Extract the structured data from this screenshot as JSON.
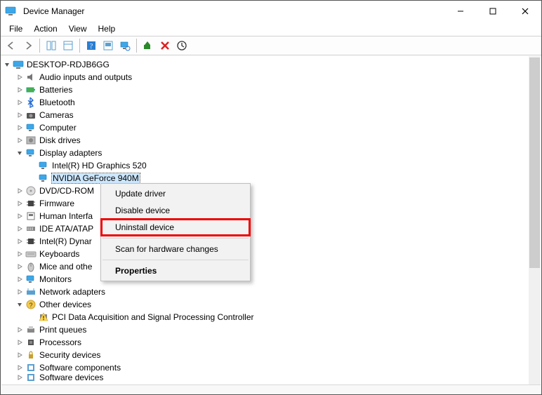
{
  "titlebar": {
    "title": "Device Manager"
  },
  "menu": {
    "file": "File",
    "action": "Action",
    "view": "View",
    "help": "Help"
  },
  "tree": {
    "root": "DESKTOP-RDJB6GG",
    "items": [
      {
        "label": "Audio inputs and outputs",
        "icon": "speaker"
      },
      {
        "label": "Batteries",
        "icon": "battery"
      },
      {
        "label": "Bluetooth",
        "icon": "bluetooth"
      },
      {
        "label": "Cameras",
        "icon": "camera"
      },
      {
        "label": "Computer",
        "icon": "monitor"
      },
      {
        "label": "Disk drives",
        "icon": "disk"
      },
      {
        "label": "Display adapters",
        "icon": "monitor",
        "expanded": true,
        "children": [
          {
            "label": "Intel(R) HD Graphics 520",
            "icon": "monitor"
          },
          {
            "label": "NVIDIA GeForce 940M",
            "icon": "monitor",
            "selected": true
          }
        ]
      },
      {
        "label": "DVD/CD-ROM",
        "icon": "dvd",
        "truncated": true
      },
      {
        "label": "Firmware",
        "icon": "chip"
      },
      {
        "label": "Human Interfa",
        "icon": "hid",
        "truncated": true
      },
      {
        "label": "IDE ATA/ATAP",
        "icon": "ide",
        "truncated": true
      },
      {
        "label": "Intel(R) Dynar",
        "icon": "chip",
        "truncated": true
      },
      {
        "label": "Keyboards",
        "icon": "keyboard"
      },
      {
        "label": "Mice and othe",
        "icon": "mouse",
        "truncated": true
      },
      {
        "label": "Monitors",
        "icon": "monitor"
      },
      {
        "label": "Network adapters",
        "icon": "network"
      },
      {
        "label": "Other devices",
        "icon": "other",
        "expanded": true,
        "children": [
          {
            "label": "PCI Data Acquisition and Signal Processing Controller",
            "icon": "warn"
          }
        ]
      },
      {
        "label": "Print queues",
        "icon": "printer"
      },
      {
        "label": "Processors",
        "icon": "cpu"
      },
      {
        "label": "Security devices",
        "icon": "security"
      },
      {
        "label": "Software components",
        "icon": "software"
      },
      {
        "label": "Software devices",
        "icon": "software",
        "cut": true
      }
    ]
  },
  "context_menu": {
    "update": "Update driver",
    "disable": "Disable device",
    "uninstall": "Uninstall device",
    "scan": "Scan for hardware changes",
    "properties": "Properties"
  }
}
